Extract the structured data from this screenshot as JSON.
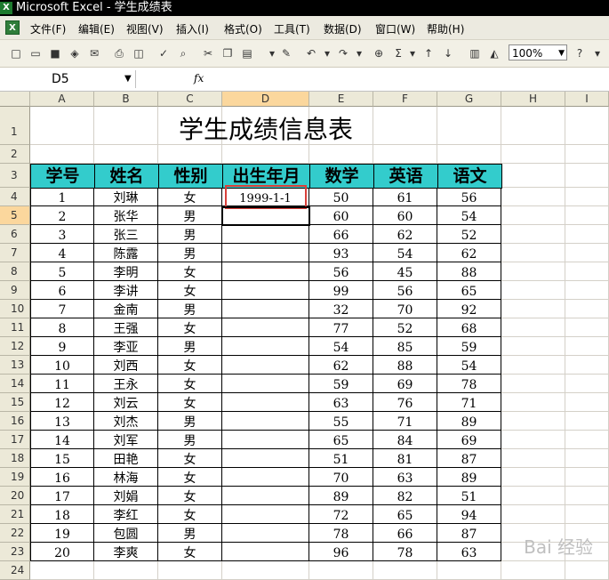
{
  "window": {
    "title": "Microsoft Excel - 学生成绩表",
    "app_icon": "excel-icon"
  },
  "menu": [
    "文件(F)",
    "编辑(E)",
    "视图(V)",
    "插入(I)",
    "格式(O)",
    "工具(T)",
    "数据(D)",
    "窗口(W)",
    "帮助(H)"
  ],
  "toolbar": {
    "zoom": "100%"
  },
  "formula": {
    "name_box": "D5",
    "fx_label": "fx",
    "value": ""
  },
  "columns": [
    "A",
    "B",
    "C",
    "D",
    "E",
    "F",
    "G",
    "H",
    "I"
  ],
  "active_cell": "D5",
  "sheet": {
    "title": "学生成绩信息表",
    "headers": [
      "学号",
      "姓名",
      "性别",
      "出生年月",
      "数学",
      "英语",
      "语文"
    ],
    "rows": [
      [
        "1",
        "刘琳",
        "女",
        "1999-1-1",
        "50",
        "61",
        "56"
      ],
      [
        "2",
        "张华",
        "男",
        "",
        "60",
        "60",
        "54"
      ],
      [
        "3",
        "张三",
        "男",
        "",
        "66",
        "62",
        "52"
      ],
      [
        "4",
        "陈露",
        "男",
        "",
        "93",
        "54",
        "62"
      ],
      [
        "5",
        "李明",
        "女",
        "",
        "56",
        "45",
        "88"
      ],
      [
        "6",
        "李讲",
        "女",
        "",
        "99",
        "56",
        "65"
      ],
      [
        "7",
        "金南",
        "男",
        "",
        "32",
        "70",
        "92"
      ],
      [
        "8",
        "王强",
        "女",
        "",
        "77",
        "52",
        "68"
      ],
      [
        "9",
        "李亚",
        "男",
        "",
        "54",
        "85",
        "59"
      ],
      [
        "10",
        "刘西",
        "女",
        "",
        "62",
        "88",
        "54"
      ],
      [
        "11",
        "王永",
        "女",
        "",
        "59",
        "69",
        "78"
      ],
      [
        "12",
        "刘云",
        "女",
        "",
        "63",
        "76",
        "71"
      ],
      [
        "13",
        "刘杰",
        "男",
        "",
        "55",
        "71",
        "89"
      ],
      [
        "14",
        "刘军",
        "男",
        "",
        "65",
        "84",
        "69"
      ],
      [
        "15",
        "田艳",
        "女",
        "",
        "51",
        "81",
        "87"
      ],
      [
        "16",
        "林海",
        "女",
        "",
        "70",
        "63",
        "89"
      ],
      [
        "17",
        "刘娟",
        "女",
        "",
        "89",
        "82",
        "51"
      ],
      [
        "18",
        "李红",
        "女",
        "",
        "72",
        "65",
        "94"
      ],
      [
        "19",
        "包圆",
        "男",
        "",
        "78",
        "66",
        "87"
      ],
      [
        "20",
        "李爽",
        "女",
        "",
        "96",
        "78",
        "63"
      ]
    ]
  },
  "row_numbers": [
    "1",
    "2",
    "3",
    "4",
    "5",
    "6",
    "7",
    "8",
    "9",
    "10",
    "11",
    "12",
    "13",
    "14",
    "15",
    "16",
    "17",
    "18",
    "19",
    "20",
    "21",
    "22",
    "23",
    "24"
  ],
  "watermark": "Bai 经验"
}
